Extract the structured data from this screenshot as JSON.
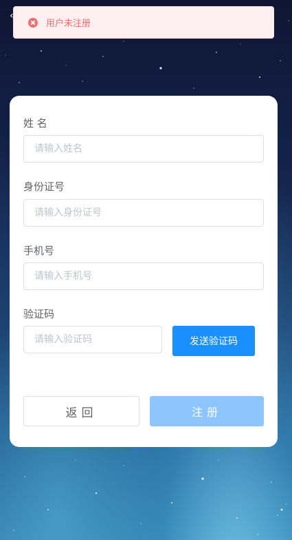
{
  "toast": {
    "icon": "error-circle-icon",
    "message": "用户未注册",
    "color": "#f56c6c"
  },
  "nav": {
    "back_glyph": "‹"
  },
  "form": {
    "name": {
      "label": "姓 名",
      "placeholder": "请输入姓名",
      "value": ""
    },
    "id_number": {
      "label": "身份证号",
      "placeholder": "请输入身份证号",
      "value": ""
    },
    "phone": {
      "label": "手机号",
      "placeholder": "请输入手机号",
      "value": ""
    },
    "code": {
      "label": "验证码",
      "placeholder": "请输入验证码",
      "value": ""
    },
    "send_code_label": "发送验证码"
  },
  "actions": {
    "back_label": "返回",
    "register_label": "注册"
  },
  "colors": {
    "primary": "#1890ff",
    "primary_disabled": "#8cc5ff",
    "error": "#f56c6c"
  }
}
